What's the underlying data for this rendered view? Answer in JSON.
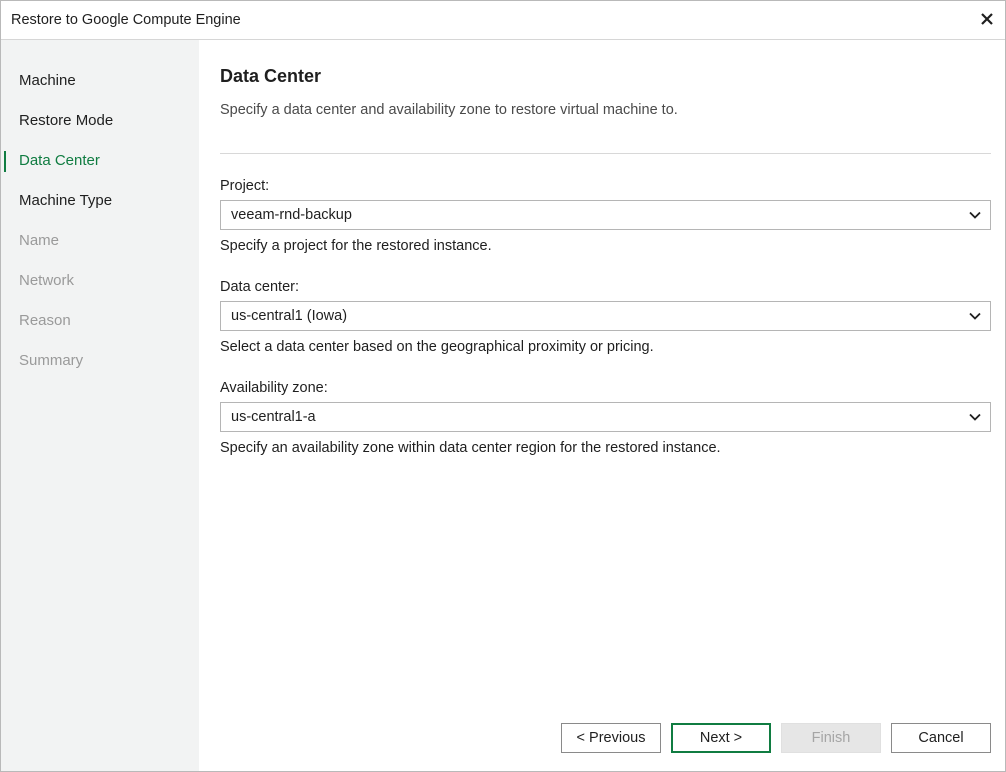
{
  "window": {
    "title": "Restore to Google Compute Engine"
  },
  "sidebar": {
    "items": [
      {
        "label": "Machine",
        "state": "completed"
      },
      {
        "label": "Restore Mode",
        "state": "completed"
      },
      {
        "label": "Data Center",
        "state": "active"
      },
      {
        "label": "Machine Type",
        "state": "available"
      },
      {
        "label": "Name",
        "state": "disabled"
      },
      {
        "label": "Network",
        "state": "disabled"
      },
      {
        "label": "Reason",
        "state": "disabled"
      },
      {
        "label": "Summary",
        "state": "disabled"
      }
    ]
  },
  "page": {
    "title": "Data Center",
    "description": "Specify a data center and availability zone to restore virtual machine to."
  },
  "fields": {
    "project": {
      "label": "Project:",
      "value": "veeam-rnd-backup",
      "hint": "Specify a project for the restored instance."
    },
    "data_center": {
      "label": "Data center:",
      "value": "us-central1 (Iowa)",
      "hint": "Select a data center based on the geographical proximity or pricing."
    },
    "availability_zone": {
      "label": "Availability zone:",
      "value": "us-central1-a",
      "hint": "Specify an availability zone within data center region for the restored instance."
    }
  },
  "buttons": {
    "previous": "< Previous",
    "next": "Next >",
    "finish": "Finish",
    "cancel": "Cancel"
  },
  "colors": {
    "accent": "#107c41",
    "sidebar_bg": "#f2f3f3",
    "disabled_text": "#9a9a9a"
  },
  "icons": {
    "close": "close-icon",
    "dropdown": "chevron-down-icon"
  }
}
